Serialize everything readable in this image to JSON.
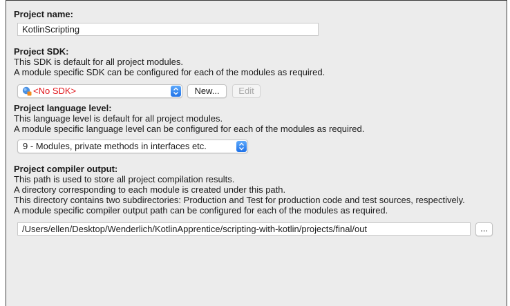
{
  "project_name": {
    "label": "Project name:",
    "value": "KotlinScripting"
  },
  "project_sdk": {
    "label": "Project SDK:",
    "desc_lines": [
      "This SDK is default for all project modules.",
      "A module specific SDK can be configured for each of the modules as required."
    ],
    "selected": "<No SDK>",
    "new_button": "New...",
    "edit_button": "Edit",
    "selected_color": "#e0161b"
  },
  "language_level": {
    "label": "Project language level:",
    "desc_lines": [
      "This language level is default for all project modules.",
      "A module specific language level can be configured for each of the modules as required."
    ],
    "selected": "9 - Modules, private methods in interfaces etc."
  },
  "compiler_output": {
    "label": "Project compiler output:",
    "desc_lines": [
      "This path is used to store all project compilation results.",
      "A directory corresponding to each module is created under this path.",
      "This directory contains two subdirectories: Production and Test for production code and test sources, respectively.",
      "A module specific compiler output path can be configured for each of the modules as required."
    ],
    "path": "/Users/ellen/Desktop/Wenderlich/KotlinApprentice/scripting-with-kotlin/projects/final/out",
    "browse_button": "..."
  },
  "icons": {
    "sdk": "sdk-icon",
    "dropdown": "dropdown-arrows-icon"
  },
  "colors": {
    "accent": "#2a7cf0",
    "panel": "#ececec"
  }
}
